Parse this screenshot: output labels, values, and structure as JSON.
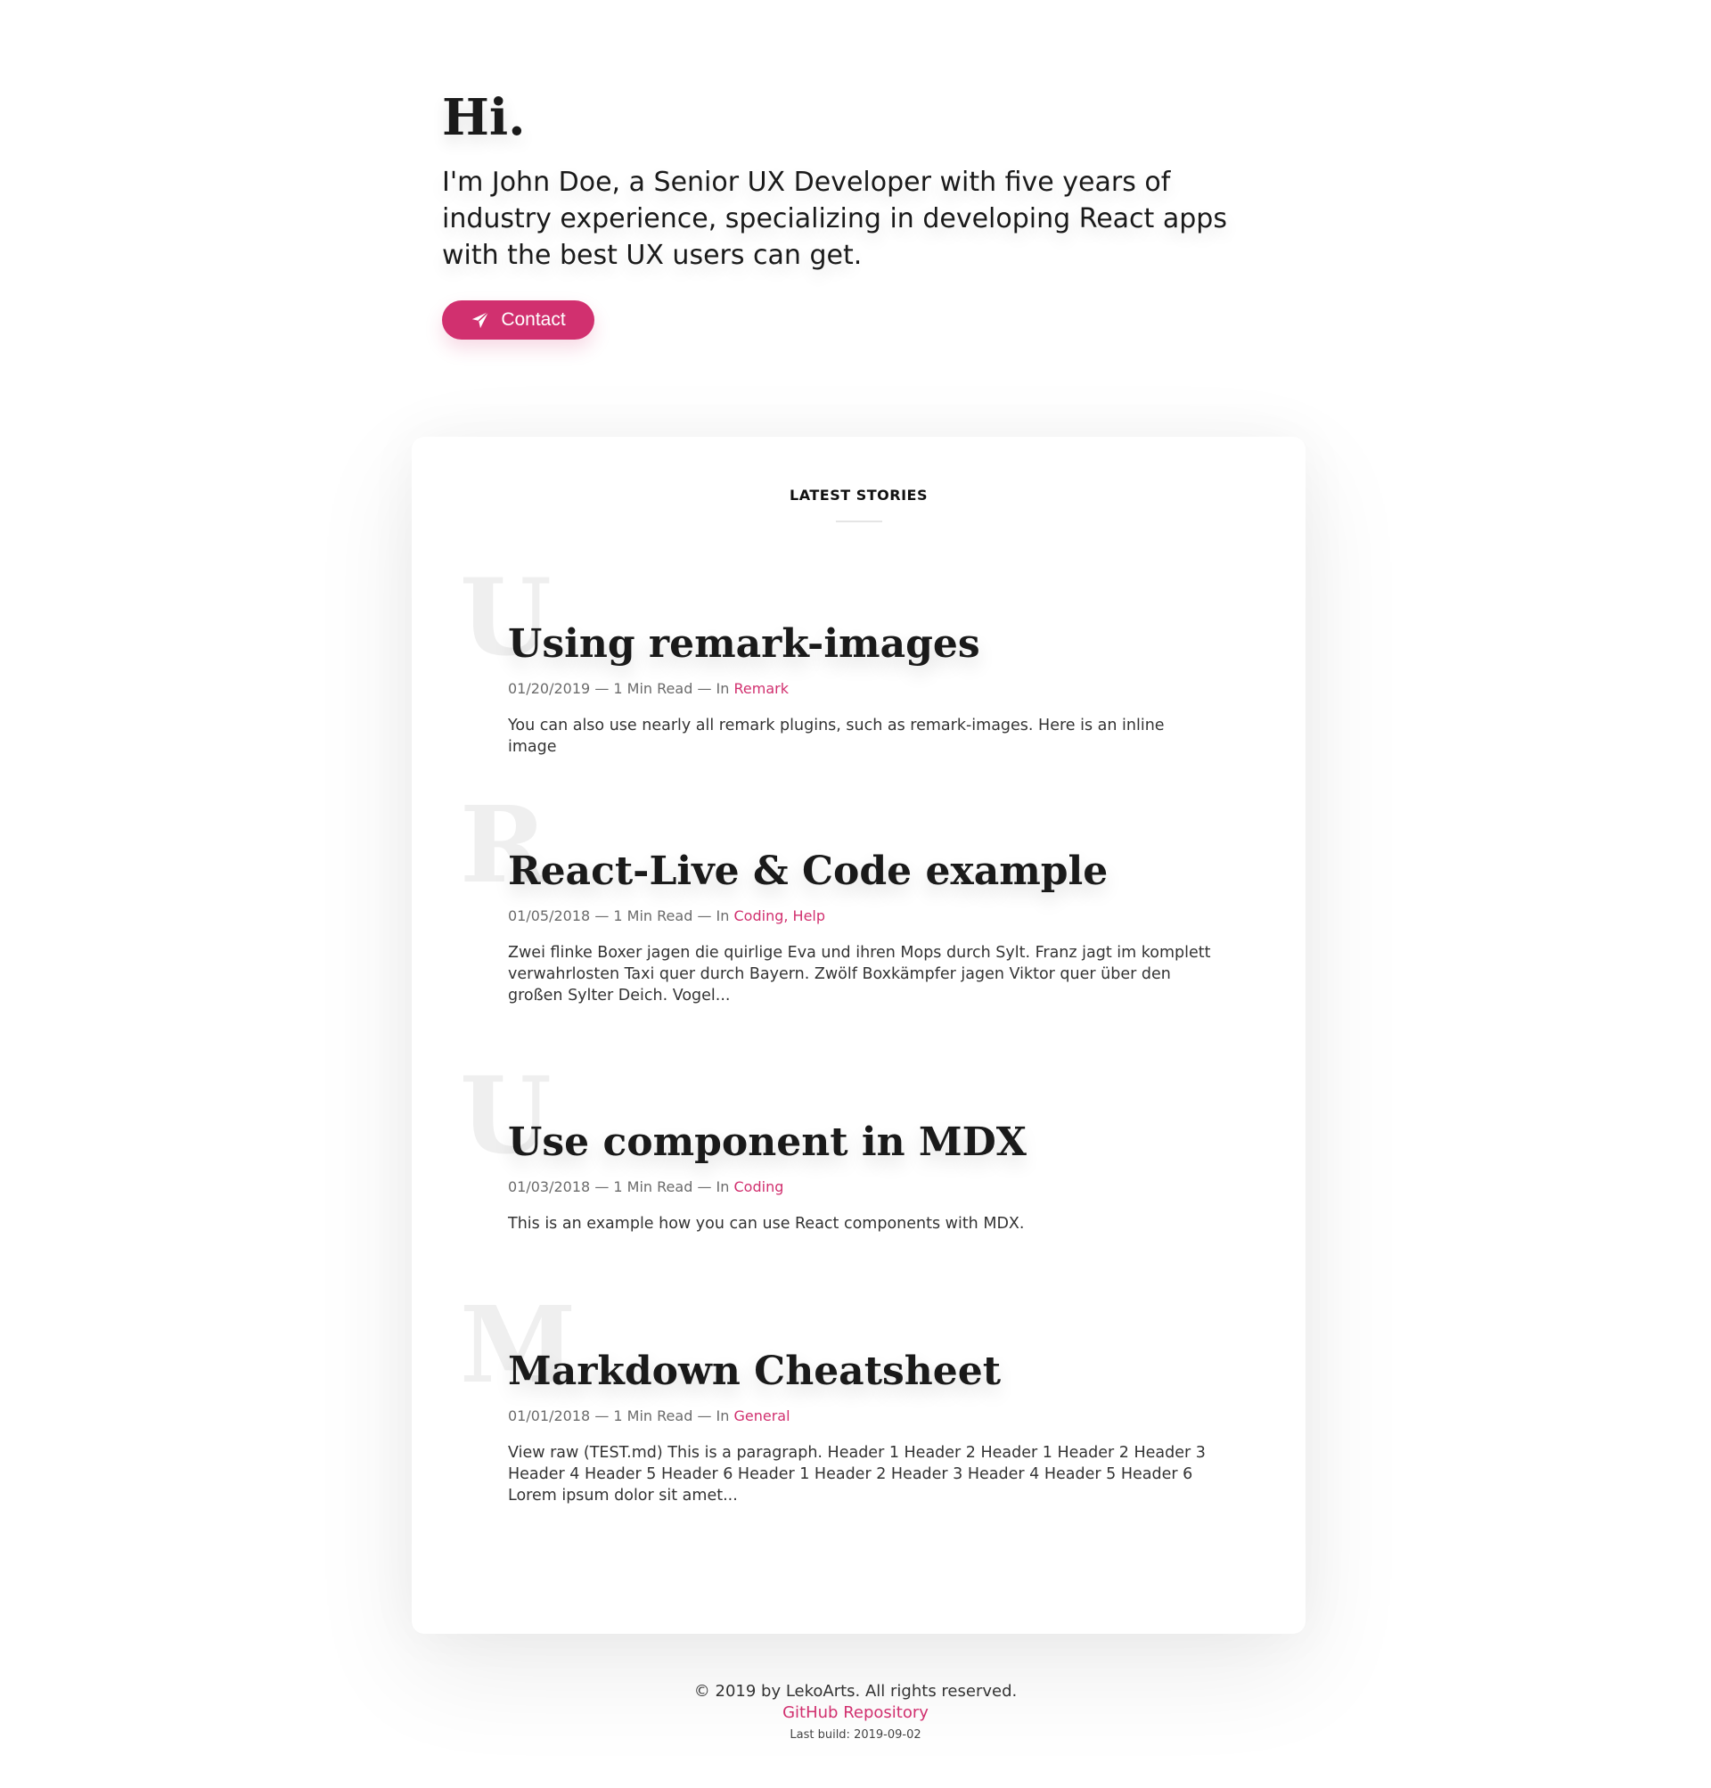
{
  "hero": {
    "title": "Hi.",
    "intro": "I'm John Doe, a Senior UX Developer with five years of industry experience, specializing in developing React apps with the best UX users can get.",
    "contact_label": "Contact",
    "contact_icon": "paper-plane-icon"
  },
  "stories": {
    "section_title": "LATEST STORIES",
    "items": [
      {
        "letter": "U",
        "title": "Using remark-images",
        "date": "01/20/2019",
        "read_time": "1 Min Read",
        "meta_in": "— In",
        "meta_sep": "—",
        "categories": [
          "Remark"
        ],
        "excerpt": "You can also use nearly all remark plugins, such as remark-images. Here is an inline image"
      },
      {
        "letter": "R",
        "title": "React-Live & Code example",
        "date": "01/05/2018",
        "read_time": "1 Min Read",
        "meta_in": "— In",
        "meta_sep": "—",
        "categories": [
          "Coding",
          "Help"
        ],
        "category_separator": ",",
        "excerpt": "Zwei flinke Boxer jagen die quirlige Eva und ihren Mops durch Sylt. Franz jagt im komplett verwahrlosten Taxi quer durch Bayern. Zwölf Boxkämpfer jagen Viktor quer über den großen Sylter Deich. Vogel..."
      },
      {
        "letter": "U",
        "title": "Use component in MDX",
        "date": "01/03/2018",
        "read_time": "1 Min Read",
        "meta_in": "— In",
        "meta_sep": "—",
        "categories": [
          "Coding"
        ],
        "excerpt": "This is an example how you can use React components with MDX."
      },
      {
        "letter": "M",
        "title": "Markdown Cheatsheet",
        "date": "01/01/2018",
        "read_time": "1 Min Read",
        "meta_in": "— In",
        "meta_sep": "—",
        "categories": [
          "General"
        ],
        "excerpt": "View raw (TEST.md) This is a paragraph. Header 1 Header 2 Header 1 Header 2 Header 3 Header 4 Header 5 Header 6 Header 1 Header 2 Header 3 Header 4 Header 5 Header 6 Lorem ipsum dolor sit amet..."
      }
    ]
  },
  "footer": {
    "copyright": "© 2019 by LekoArts. All rights reserved.",
    "repo_link": "GitHub Repository",
    "last_build": "Last build: 2019-09-02"
  },
  "colors": {
    "accent": "#d1306f",
    "text": "#1a1a1a",
    "meta": "#6b6b6b",
    "watermark_letter": "#efefef"
  }
}
